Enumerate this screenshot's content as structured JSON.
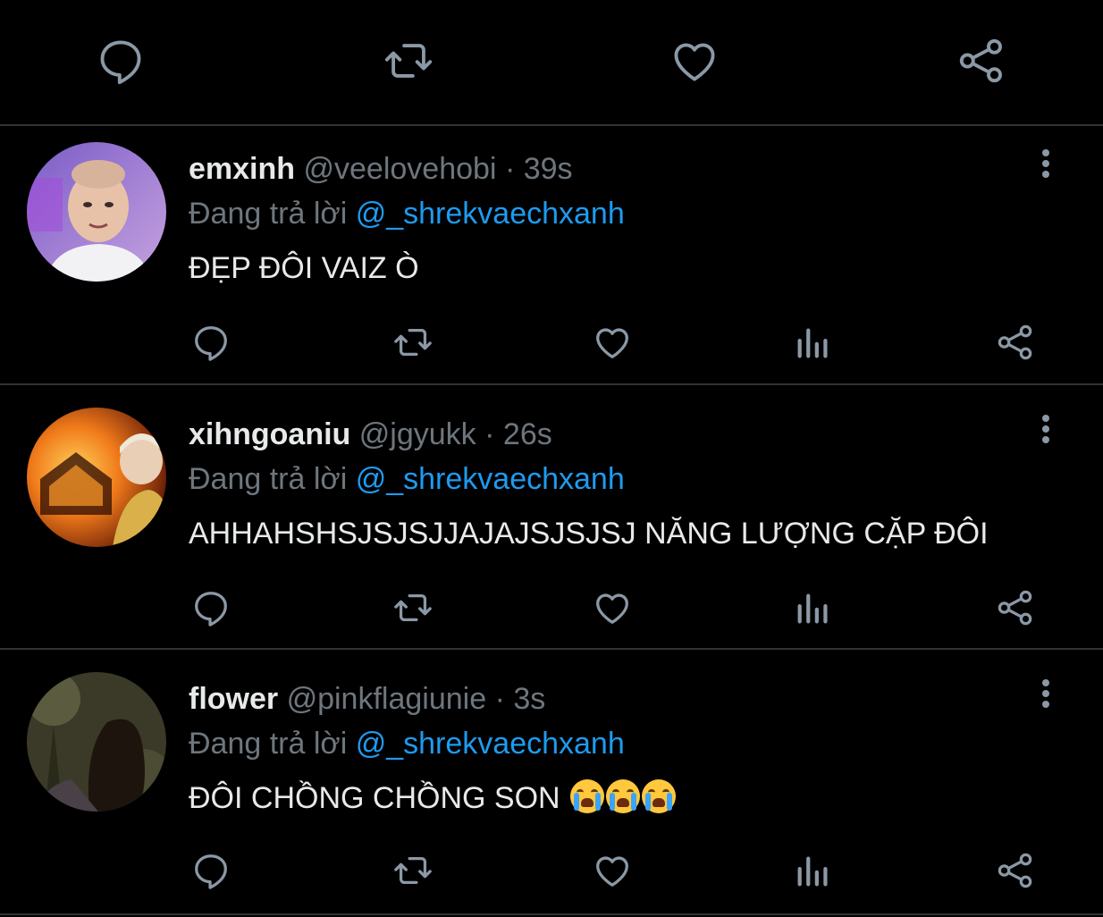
{
  "replies": [
    {
      "display_name": "emxinh",
      "handle": "@veelovehobi",
      "separator": "·",
      "time": "39s",
      "replying_label": "Đang trả lời",
      "replying_to": "@_shrekvaechxanh",
      "text": "ĐẸP ĐÔI VAIZ Ò"
    },
    {
      "display_name": "xihngoaniu",
      "handle": "@jgyukk",
      "separator": "·",
      "time": "26s",
      "replying_label": "Đang trả lời",
      "replying_to": "@_shrekvaechxanh",
      "text": "AHHAHSHSJSJSJJAJAJSJSJSJ NĂNG LƯỢNG CẶP ĐÔI"
    },
    {
      "display_name": "flower",
      "handle": "@pinkflagiunie",
      "separator": "·",
      "time": "3s",
      "replying_label": "Đang trả lời",
      "replying_to": "@_shrekvaechxanh",
      "text": "ĐÔI CHỒNG CHỒNG SON",
      "emoji": [
        "loudly-crying-face",
        "loudly-crying-face",
        "loudly-crying-face"
      ]
    }
  ],
  "icons": {
    "reply": "reply-icon",
    "retweet": "retweet-icon",
    "like": "heart-icon",
    "analytics": "analytics-icon",
    "share": "share-icon",
    "more": "more-options-icon"
  },
  "colors": {
    "background": "#000000",
    "text": "#e7e9ea",
    "muted": "#6e767d",
    "icon": "#8b98a5",
    "mention": "#1d9bf0",
    "divider": "#2f3336"
  }
}
